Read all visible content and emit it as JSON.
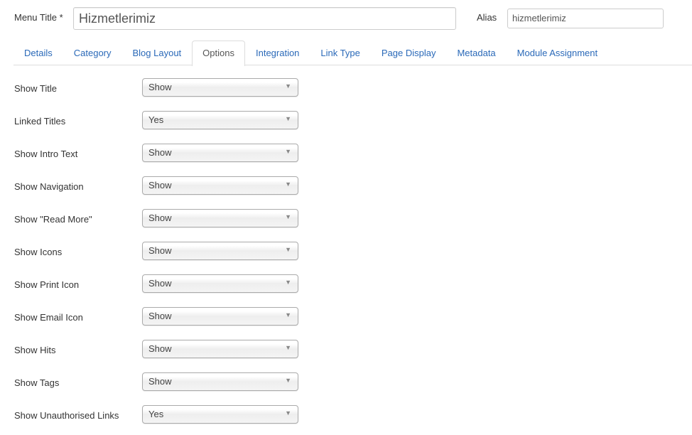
{
  "header": {
    "menu_title_label": "Menu Title *",
    "menu_title_value": "Hizmetlerimiz",
    "alias_label": "Alias",
    "alias_value": "hizmetlerimiz"
  },
  "tabs": [
    {
      "label": "Details"
    },
    {
      "label": "Category"
    },
    {
      "label": "Blog Layout"
    },
    {
      "label": "Options",
      "active": true
    },
    {
      "label": "Integration"
    },
    {
      "label": "Link Type"
    },
    {
      "label": "Page Display"
    },
    {
      "label": "Metadata"
    },
    {
      "label": "Module Assignment"
    }
  ],
  "options": [
    {
      "label": "Show Title",
      "value": "Show"
    },
    {
      "label": "Linked Titles",
      "value": "Yes"
    },
    {
      "label": "Show Intro Text",
      "value": "Show"
    },
    {
      "label": "Show Navigation",
      "value": "Show"
    },
    {
      "label": "Show \"Read More\"",
      "value": "Show"
    },
    {
      "label": "Show Icons",
      "value": "Show"
    },
    {
      "label": "Show Print Icon",
      "value": "Show"
    },
    {
      "label": "Show Email Icon",
      "value": "Show"
    },
    {
      "label": "Show Hits",
      "value": "Show"
    },
    {
      "label": "Show Tags",
      "value": "Show"
    },
    {
      "label": "Show Unauthorised Links",
      "value": "Yes"
    }
  ],
  "icons": {
    "dropdown": "▼"
  }
}
